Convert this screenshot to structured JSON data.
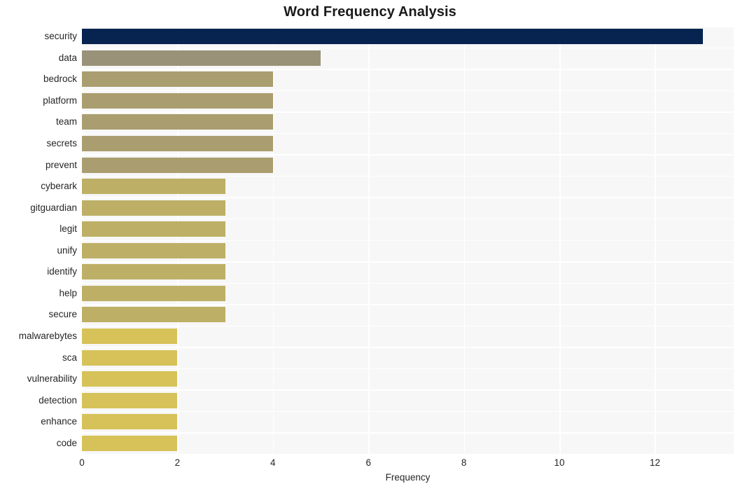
{
  "chart_data": {
    "type": "bar",
    "orientation": "horizontal",
    "title": "Word Frequency Analysis",
    "xlabel": "Frequency",
    "ylabel": "",
    "xlim": [
      0,
      13.65
    ],
    "xticks": [
      0,
      2,
      4,
      6,
      8,
      10,
      12
    ],
    "grid": true,
    "legend": null,
    "categories": [
      "security",
      "data",
      "bedrock",
      "platform",
      "team",
      "secrets",
      "prevent",
      "cyberark",
      "gitguardian",
      "legit",
      "unify",
      "identify",
      "help",
      "secure",
      "malwarebytes",
      "sca",
      "vulnerability",
      "detection",
      "enhance",
      "code"
    ],
    "values": [
      13,
      5,
      4,
      4,
      4,
      4,
      4,
      3,
      3,
      3,
      3,
      3,
      3,
      3,
      2,
      2,
      2,
      2,
      2,
      2
    ],
    "bar_colors": [
      "#07234f",
      "#999278",
      "#aa9e70",
      "#aa9e70",
      "#aa9e70",
      "#aa9e70",
      "#aa9e70",
      "#bdb066",
      "#bdb066",
      "#bdb066",
      "#bdb066",
      "#bdb066",
      "#bdb066",
      "#bdb066",
      "#d6c259",
      "#d6c259",
      "#d6c259",
      "#d6c259",
      "#d6c259",
      "#d6c259"
    ]
  },
  "style": {
    "plot_background": "#f7f7f7",
    "grid_color": "#ffffff",
    "page_background": "#ffffff",
    "text_color": "#262626",
    "title_color": "#1a1a1a"
  }
}
